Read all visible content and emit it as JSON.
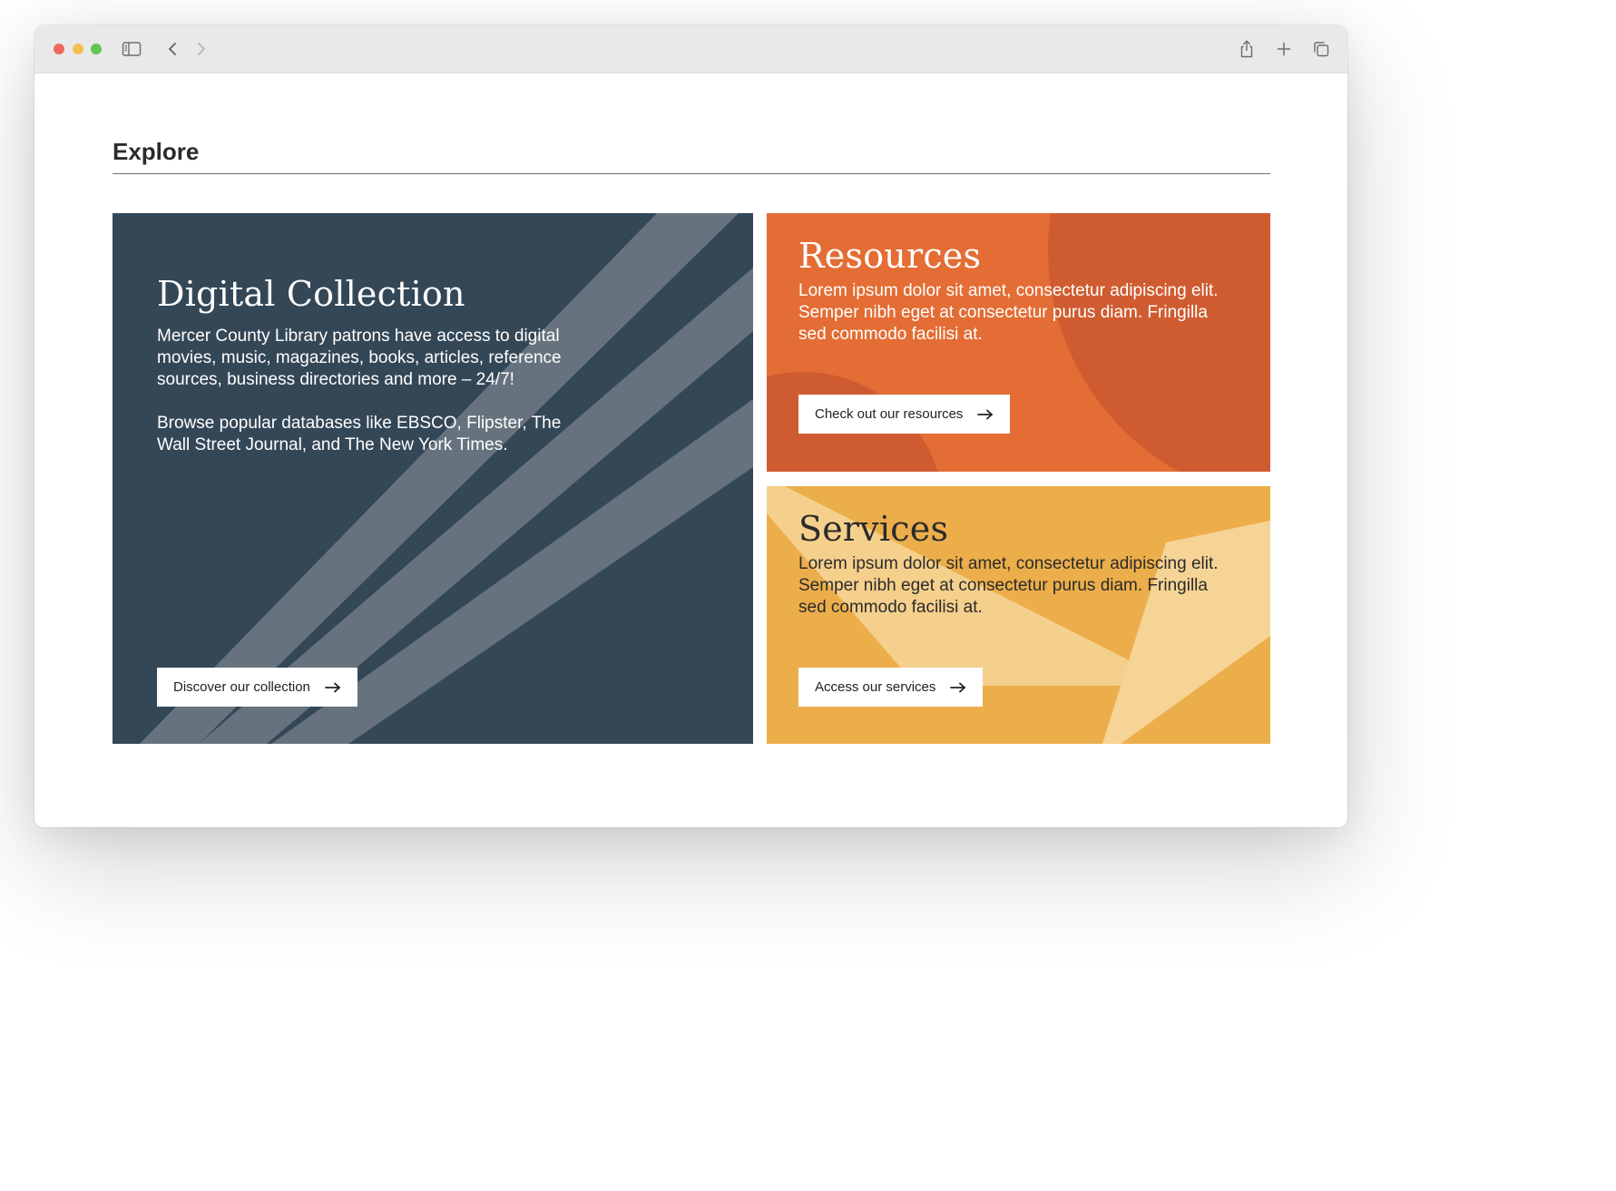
{
  "browser": {
    "traffic_lights": [
      "close",
      "minimize",
      "zoom"
    ],
    "toolbar_icons": [
      "sidebar-icon",
      "back-icon",
      "forward-icon",
      "share-icon",
      "new-tab-icon",
      "tabs-overview-icon"
    ]
  },
  "section": {
    "title": "Explore"
  },
  "cards": {
    "digital": {
      "title": "Digital Collection",
      "paragraph1": "Mercer County Library patrons have access to digital movies, music, magazines, books, articles, reference sources, business directories and more – 24/7!",
      "paragraph2": "Browse popular databases like EBSCO, Flipster, The Wall Street Journal, and The New York Times.",
      "button_label": "Discover our collection",
      "color": "#344757"
    },
    "resources": {
      "title": "Resources",
      "paragraph": "Lorem ipsum dolor sit amet, consectetur adipiscing elit. Semper nibh eget at consectetur purus diam. Fringilla sed commodo facilisi at.",
      "button_label": "Check out our resources",
      "color": "#e36d34"
    },
    "services": {
      "title": "Services",
      "paragraph": "Lorem ipsum dolor sit amet, consectetur adipiscing elit. Semper nibh eget at consectetur purus diam. Fringilla sed commodo facilisi at.",
      "button_label": "Access our services",
      "color": "#ecae4b"
    }
  },
  "icons": {
    "cta_arrow": "arrow-right-icon"
  }
}
